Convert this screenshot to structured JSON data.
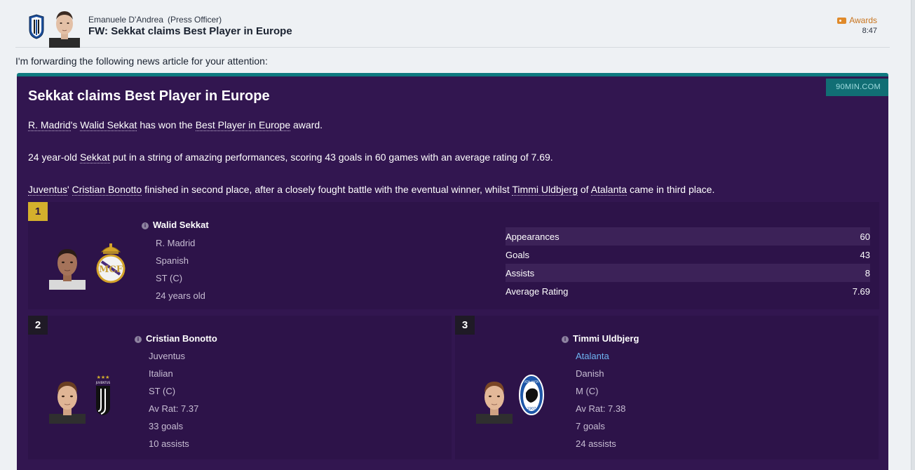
{
  "header": {
    "sender_name": "Emanuele D'Andrea",
    "sender_role": "(Press Officer)",
    "subject": "FW: Sekkat claims Best Player in Europe",
    "tag": "Awards",
    "time": "8:47"
  },
  "intro": "I'm forwarding the following news article for your attention:",
  "article": {
    "source": "90MIN.COM",
    "title": "Sekkat claims Best Player in Europe",
    "p1": {
      "club": "R. Madrid",
      "apos": "'s ",
      "player": "Walid Sekkat",
      "mid": " has won the ",
      "award": "Best Player in Europe",
      "end": " award."
    },
    "p2": {
      "start": "24 year-old ",
      "player": "Sekkat",
      "end": " put in a string of amazing performances, scoring 43 goals in 60 games with an average rating of 7.69."
    },
    "p3": {
      "club1": "Juventus",
      "apos": "' ",
      "player1": "Cristian Bonotto",
      "mid": " finished in second place, after a closely fought battle with the eventual winner, whilst ",
      "player2": "Timmi Uldbjerg",
      "of": " of ",
      "club2": "Atalanta",
      "end": " came in third place."
    }
  },
  "first": {
    "rank": "1",
    "name": "Walid Sekkat",
    "club": "R. Madrid",
    "nationality": "Spanish",
    "position": "ST (C)",
    "age": "24 years old",
    "stats": [
      {
        "label": "Appearances",
        "value": "60"
      },
      {
        "label": "Goals",
        "value": "43"
      },
      {
        "label": "Assists",
        "value": "8"
      },
      {
        "label": "Average Rating",
        "value": "7.69"
      }
    ]
  },
  "second": {
    "rank": "2",
    "name": "Cristian Bonotto",
    "club": "Juventus",
    "nationality": "Italian",
    "position": "ST (C)",
    "rating": "Av Rat: 7.37",
    "goals": "33 goals",
    "assists": "10 assists"
  },
  "third": {
    "rank": "3",
    "name": "Timmi Uldbjerg",
    "club": "Atalanta",
    "nationality": "Danish",
    "position": "M (C)",
    "rating": "Av Rat: 7.38",
    "goals": "7 goals",
    "assists": "24 assists"
  },
  "crest_text": {
    "juventus_top": "JUVENTUS",
    "atalanta_top": "ATALANTA",
    "atalanta_year": "1907"
  },
  "colors": {
    "card_bg": "#321650",
    "panel_bg": "#2d1349",
    "card_accent": "#0f7a80",
    "gold_rank": "#d4b02c",
    "tag": "#c8741d",
    "link": "#6fb4f2"
  }
}
